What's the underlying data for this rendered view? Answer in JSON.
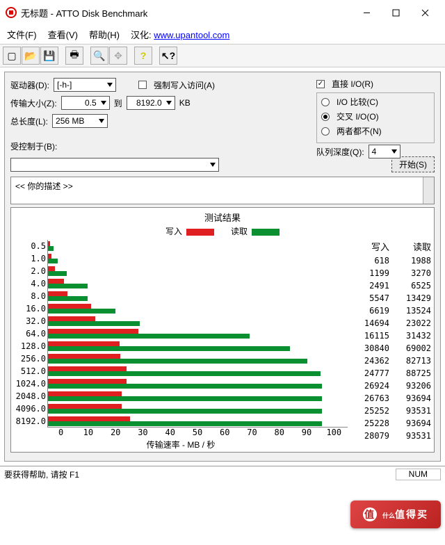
{
  "window": {
    "title": "无标题 - ATTO Disk Benchmark"
  },
  "menu": {
    "file": "文件(F)",
    "view": "查看(V)",
    "help": "帮助(H)",
    "translate_label": "汉化:",
    "translate_url": "www.upantool.com"
  },
  "toolbar_icons": [
    "new",
    "open",
    "save",
    "print",
    "preview",
    "move",
    "help",
    "arrow"
  ],
  "form": {
    "drive_label": "驱动器(D):",
    "drive_value": "[-h-]",
    "xfer_label": "传输大小(Z):",
    "xfer_from": "0.5",
    "xfer_to_label": "到",
    "xfer_to": "8192.0",
    "xfer_unit": "KB",
    "len_label": "总长度(L):",
    "len_value": "256 MB",
    "force_write": "强制写入访问(A)",
    "direct_io": "直接 I/O(R)",
    "io_compare": "I/O 比较(C)",
    "overlapped": "交叉 I/O(O)",
    "neither": "两者都不(N)",
    "queue_label": "队列深度(Q):",
    "queue_value": "4",
    "controlled_label": "受控制于(B):",
    "start_btn": "开始(S)",
    "desc_text": "<<   你的描述   >>"
  },
  "results": {
    "title": "测试结果",
    "legend_write": "写入",
    "legend_read": "读取",
    "col_write": "写入",
    "col_read": "读取",
    "xaxis_label": "传输速率 - MB / 秒"
  },
  "chart_data": {
    "type": "bar",
    "xlabel": "传输速率 - MB / 秒",
    "xlim": [
      0,
      100
    ],
    "xticks": [
      0,
      10,
      20,
      30,
      40,
      50,
      60,
      70,
      80,
      90,
      100
    ],
    "categories": [
      "0.5",
      "1.0",
      "2.0",
      "4.0",
      "8.0",
      "16.0",
      "32.0",
      "64.0",
      "128.0",
      "256.0",
      "512.0",
      "1024.0",
      "2048.0",
      "4096.0",
      "8192.0"
    ],
    "series": [
      {
        "name": "写入",
        "color": "#e02020",
        "values_kb": [
          618,
          1199,
          2491,
          5547,
          6619,
          14694,
          16115,
          30840,
          24362,
          24777,
          26924,
          26763,
          25252,
          25228,
          28079
        ]
      },
      {
        "name": "读取",
        "color": "#0a9030",
        "values_kb": [
          1988,
          3270,
          6525,
          13429,
          13524,
          23022,
          31432,
          69002,
          82713,
          88725,
          93206,
          93694,
          93531,
          93694,
          93531
        ]
      }
    ]
  },
  "status": {
    "help": "要获得帮助, 请按 F1",
    "num": "NUM"
  },
  "watermark": {
    "main": "值得买",
    "sub": "什么"
  }
}
